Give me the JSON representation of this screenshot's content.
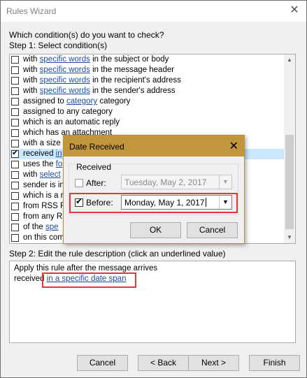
{
  "window": {
    "title": "Rules Wizard",
    "close_glyph": "✕"
  },
  "step1": {
    "question": "Which condition(s) do you want to check?",
    "label": "Step 1: Select condition(s)",
    "conditions": [
      {
        "checked": false,
        "pre": "with ",
        "link": "specific words",
        "post": " in the subject or body"
      },
      {
        "checked": false,
        "pre": "with ",
        "link": "specific words",
        "post": " in the message header"
      },
      {
        "checked": false,
        "pre": "with ",
        "link": "specific words",
        "post": " in the recipient's address"
      },
      {
        "checked": false,
        "pre": "with ",
        "link": "specific words",
        "post": " in the sender's address"
      },
      {
        "checked": false,
        "pre": "assigned to ",
        "link": "category",
        "post": " category"
      },
      {
        "checked": false,
        "pre": "assigned to any category",
        "link": "",
        "post": ""
      },
      {
        "checked": false,
        "pre": "which is an automatic reply",
        "link": "",
        "post": ""
      },
      {
        "checked": false,
        "pre": "which has an attachment",
        "link": "",
        "post": ""
      },
      {
        "checked": false,
        "pre": "with a size",
        "link": "",
        "post": ""
      },
      {
        "checked": true,
        "pre": "received ",
        "link": "in",
        "post": ""
      },
      {
        "checked": false,
        "pre": "uses the ",
        "link": "fo",
        "post": ""
      },
      {
        "checked": false,
        "pre": "with ",
        "link": "select",
        "post": ""
      },
      {
        "checked": false,
        "pre": "sender is in",
        "link": "",
        "post": ""
      },
      {
        "checked": false,
        "pre": "which is a m",
        "link": "",
        "post": ""
      },
      {
        "checked": false,
        "pre": "from RSS F",
        "link": "",
        "post": ""
      },
      {
        "checked": false,
        "pre": "from any RS",
        "link": "",
        "post": ""
      },
      {
        "checked": false,
        "pre": "of the ",
        "link": "spe",
        "post": ""
      },
      {
        "checked": false,
        "pre": "on this com",
        "link": "",
        "post": ""
      }
    ]
  },
  "step2": {
    "label": "Step 2: Edit the rule description (click an underlined value)",
    "line1": "Apply this rule after the message arrives",
    "line2_pre": "received ",
    "line2_link": "in a specific date span"
  },
  "buttons": {
    "cancel": "Cancel",
    "back": "< Back",
    "next": "Next >",
    "finish": "Finish"
  },
  "dialog": {
    "title": "Date Received",
    "close_glyph": "✕",
    "group_label": "Received",
    "after": {
      "label": "After:",
      "checked": false,
      "value": "Tuesday, May 2, 2017"
    },
    "before": {
      "label": "Before:",
      "checked": true,
      "value": "Monday, May 1, 2017"
    },
    "ok": "OK",
    "cancel": "Cancel"
  },
  "icons": {
    "checkmark": "✔",
    "dropdown": "▼",
    "scroll_up": "▲",
    "scroll_down": "▼"
  },
  "colors": {
    "dialog_title": "#c2963c",
    "link": "#1f4e9c",
    "highlight": "#e0393c",
    "selection": "#cce8ff"
  }
}
